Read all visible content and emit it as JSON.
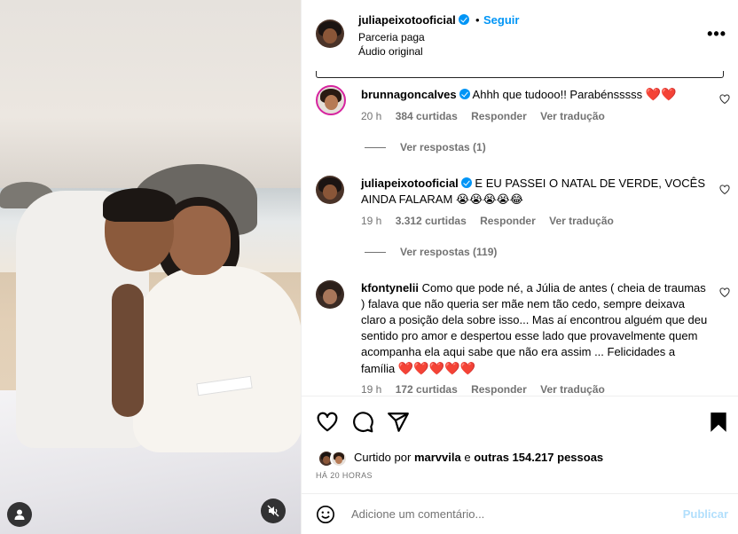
{
  "header": {
    "username": "juliapeixotooficial",
    "separator": "•",
    "follow_label": "Seguir",
    "subtitle_1": "Parceria paga",
    "subtitle_2": "Áudio original",
    "more_icon": "more-horizontal-icon"
  },
  "comments": [
    {
      "username": "brunnagoncalves",
      "verified": true,
      "text": "Ahhh que tudooo!! Parabénsssss",
      "emoji": "❤️❤️",
      "time": "20 h",
      "likes": "384 curtidas",
      "reply_label": "Responder",
      "translate_label": "Ver tradução",
      "replies_label": "Ver respostas (1)"
    },
    {
      "username": "juliapeixotooficial",
      "verified": true,
      "text": "E EU PASSEI O NATAL DE VERDE, VOCÊS AINDA FALARAM",
      "emoji": "😭😭😭😭😂",
      "time": "19 h",
      "likes": "3.312 curtidas",
      "reply_label": "Responder",
      "translate_label": "Ver tradução",
      "replies_label": "Ver respostas (119)"
    },
    {
      "username": "kfontynelii",
      "verified": false,
      "text": "Como que pode né, a Júlia de antes ( cheia de traumas ) falava que não queria ser mãe nem tão cedo, sempre deixava claro a posição dela sobre isso... Mas aí encontrou alguém que deu sentido pro amor e despertou esse lado que provavelmente quem acompanha ela aqui sabe que não era assim ... Felicidades a família",
      "emoji": "❤️❤️❤️❤️❤️",
      "time": "19 h",
      "likes": "172 curtidas",
      "reply_label": "Responder",
      "translate_label": "Ver tradução"
    }
  ],
  "actions": {
    "like_icon": "heart-outline-icon",
    "comment_icon": "comment-icon",
    "share_icon": "send-icon",
    "save_icon": "bookmark-filled-icon"
  },
  "likes": {
    "prefix": "Curtido por",
    "user": "marvvila",
    "middle": "e",
    "others": "outras 154.217 pessoas"
  },
  "time_ago": "HÁ 20 HORAS",
  "add_comment": {
    "emoji_icon": "smiley-icon",
    "placeholder": "Adicione um comentário...",
    "publish_label": "Publicar"
  },
  "media": {
    "tag_icon": "user-tag-icon",
    "mute_icon": "muted-speaker-icon"
  },
  "colors": {
    "accent": "#0095f6",
    "heart": "#e0202b",
    "muted_text": "#737373",
    "publish_disabled": "#b2dffc"
  }
}
